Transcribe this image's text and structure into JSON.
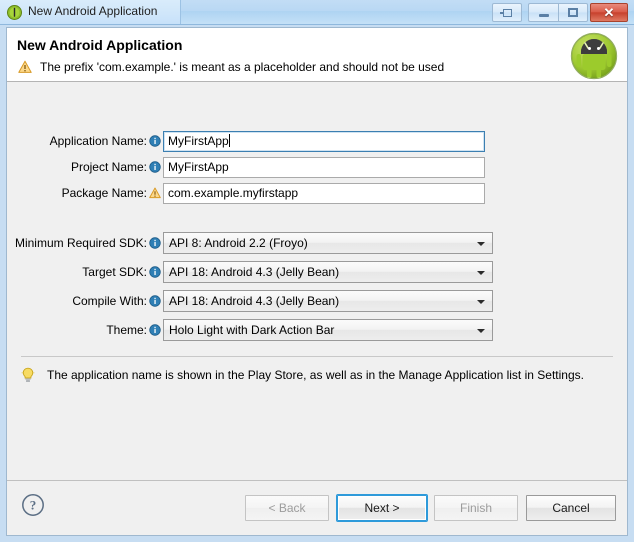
{
  "window": {
    "title": "New Android Application",
    "icon": "android-icon",
    "controls": {
      "restore_label": "Restore",
      "minimize_label": "Minimize",
      "maximize_label": "Maximize",
      "close_label": "Close"
    }
  },
  "header": {
    "title": "New Android Application",
    "warning_icon": "warning-triangle-icon",
    "warning_text": "The prefix 'com.example.' is meant as a placeholder and should not be used",
    "logo_icon": "android-robot-logo"
  },
  "form": {
    "text_fields": [
      {
        "label": "Application Name:",
        "icon": "info-icon",
        "value": "MyFirstApp",
        "placeholder": "",
        "focused": true
      },
      {
        "label": "Project Name:",
        "icon": "info-icon",
        "value": "MyFirstApp",
        "placeholder": "",
        "focused": false
      },
      {
        "label": "Package Name:",
        "icon": "warning-triangle-icon",
        "value": "com.example.myfirstapp",
        "placeholder": "",
        "focused": false
      }
    ],
    "dropdowns": [
      {
        "label": "Minimum Required SDK:",
        "icon": "info-icon",
        "value": "API 8: Android 2.2 (Froyo)"
      },
      {
        "label": "Target SDK:",
        "icon": "info-icon",
        "value": "API 18: Android 4.3 (Jelly Bean)"
      },
      {
        "label": "Compile With:",
        "icon": "info-icon",
        "value": "API 18: Android 4.3 (Jelly Bean)"
      },
      {
        "label": "Theme:",
        "icon": "info-icon",
        "value": "Holo Light with Dark Action Bar"
      }
    ]
  },
  "hint": {
    "icon": "lightbulb-icon",
    "text": "The application name is shown in the Play Store, as well as in the Manage Application list in Settings."
  },
  "buttonbar": {
    "help_icon": "help-question-icon",
    "buttons": [
      {
        "label": "< Back",
        "state": "disabled"
      },
      {
        "label": "Next >",
        "state": "default"
      },
      {
        "label": "Finish",
        "state": "disabled"
      },
      {
        "label": "Cancel",
        "state": "normal"
      }
    ]
  },
  "colors": {
    "titlebar_blue": "#c2ddf5",
    "body_gray": "#f0f0f0",
    "focus_blue": "#2e9ada",
    "close_red": "#c63f2c",
    "android_green": "#a4c639",
    "warning_orange": "#e8a33d",
    "info_blue": "#2a7ab0",
    "bulb_yellow": "#f5d24a"
  }
}
